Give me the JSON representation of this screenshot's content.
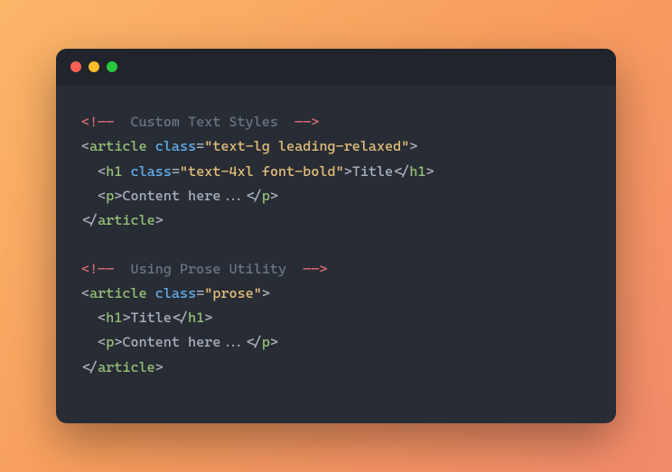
{
  "comment1_open": "<!——",
  "comment1_text": "Custom Text Styles",
  "comment1_close": "——>",
  "lt": "<",
  "gt": ">",
  "slash": "/",
  "tag_article": "article",
  "tag_h1": "h1",
  "tag_p": "p",
  "attr_class": "class",
  "eq": "=",
  "q": "\"",
  "val_article1": "text-lg leading-relaxed",
  "val_h1_1": "text-4xl font-bold",
  "title_text": "Title",
  "content_text": "Content here...",
  "comment2_text": "Using Prose Utility",
  "val_article2": "prose"
}
